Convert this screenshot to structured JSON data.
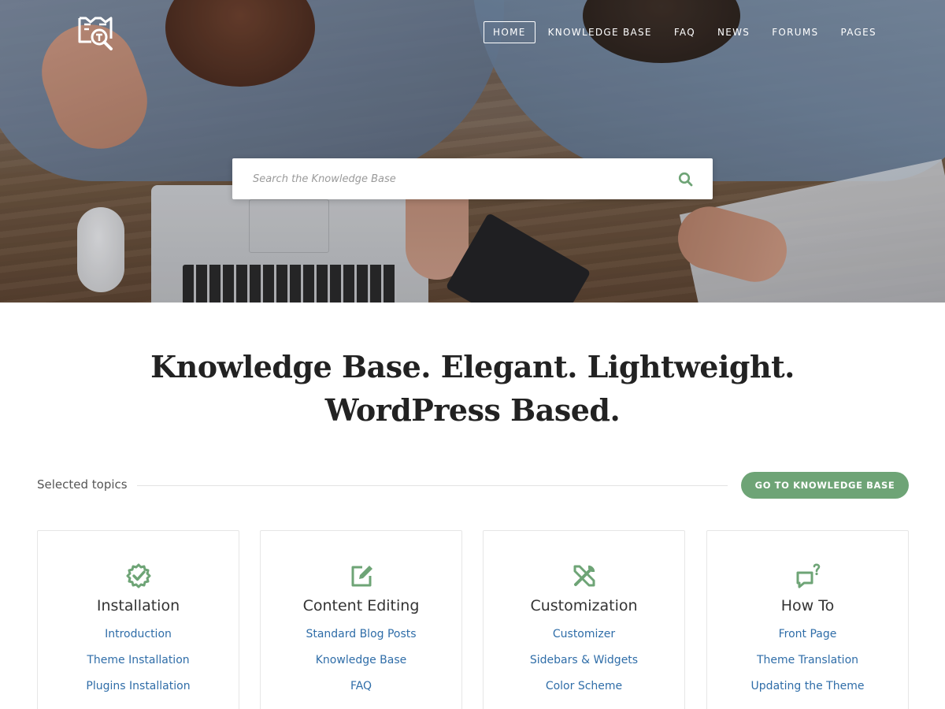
{
  "nav": {
    "items": [
      "HOME",
      "KNOWLEDGE BASE",
      "FAQ",
      "NEWS",
      "FORUMS",
      "PAGES"
    ],
    "active": "HOME"
  },
  "search": {
    "placeholder": "Search the Knowledge Base"
  },
  "headline": {
    "line1": "Knowledge Base. Elegant. Lightweight.",
    "line2": "WordPress Based."
  },
  "topics": {
    "label": "Selected topics",
    "button_label": "GO TO KNOWLEDGE BASE"
  },
  "colors": {
    "accent": "#6ea476",
    "link": "#2f6da8",
    "heading": "#222222"
  },
  "cards": [
    {
      "title": "Installation",
      "icon": "gear-check-icon",
      "links": [
        "Introduction",
        "Theme Installation",
        "Plugins Installation"
      ]
    },
    {
      "title": "Content Editing",
      "icon": "edit-icon",
      "links": [
        "Standard Blog Posts",
        "Knowledge Base",
        "FAQ"
      ]
    },
    {
      "title": "Customization",
      "icon": "tools-icon",
      "links": [
        "Customizer",
        "Sidebars & Widgets",
        "Color Scheme"
      ]
    },
    {
      "title": "How To",
      "icon": "question-chat-icon",
      "links": [
        "Front Page",
        "Theme Translation",
        "Updating the Theme"
      ]
    }
  ]
}
